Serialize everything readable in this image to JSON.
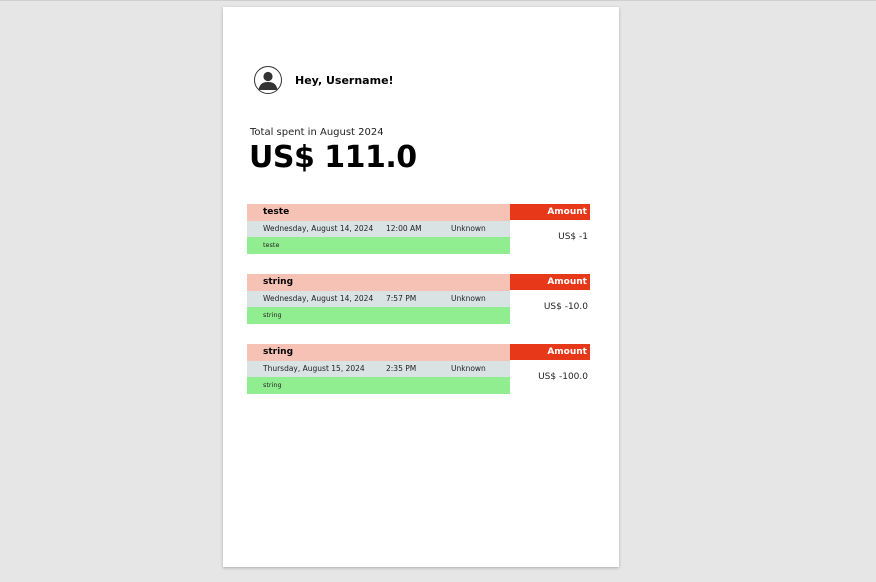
{
  "header": {
    "greeting": "Hey, Username!",
    "avatar_icon": "user-circle-icon"
  },
  "summary": {
    "label": "Total spent in August 2024",
    "amount": "US$ 111.0"
  },
  "transactions": [
    {
      "name": "teste",
      "amount_header": "Amount",
      "date": "Wednesday, August 14, 2024",
      "time": "12:00 AM",
      "location": "Unknown",
      "description": "teste",
      "value": "US$ -1"
    },
    {
      "name": "string",
      "amount_header": "Amount",
      "date": "Wednesday, August 14, 2024",
      "time": "7:57 PM",
      "location": "Unknown",
      "description": "string",
      "value": "US$ -10.0"
    },
    {
      "name": "string",
      "amount_header": "Amount",
      "date": "Thursday, August 15, 2024",
      "time": "2:35 PM",
      "location": "Unknown",
      "description": "string",
      "value": "US$ -100.0"
    }
  ],
  "colors": {
    "name_bg": "#f5c2b5",
    "amount_header_bg": "#e8381a",
    "meta_bg": "#d9e3e3",
    "desc_bg": "#90ee90"
  }
}
